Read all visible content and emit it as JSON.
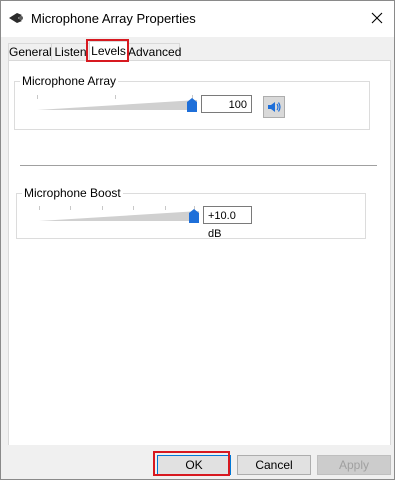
{
  "window": {
    "title": "Microphone Array Properties"
  },
  "tabs": [
    {
      "label": "General"
    },
    {
      "label": "Listen"
    },
    {
      "label": "Levels"
    },
    {
      "label": "Advanced"
    }
  ],
  "active_tab": "Levels",
  "levels": {
    "array": {
      "label": "Microphone Array",
      "value": "100",
      "level": 1.0
    },
    "boost": {
      "label": "Microphone Boost",
      "value": "+10.0 dB",
      "level": 1.0
    }
  },
  "footer": {
    "ok_label": "OK",
    "cancel_label": "Cancel",
    "apply_label": "Apply"
  },
  "colors": {
    "highlight": "#d71920",
    "accent": "#0078d7",
    "thumb": "#1e6fd9"
  }
}
